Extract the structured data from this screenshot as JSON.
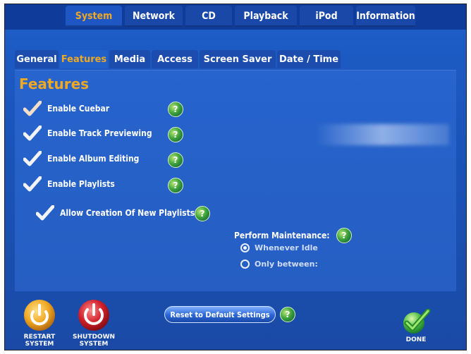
{
  "top_tabs": [
    {
      "label": "System",
      "active": true
    },
    {
      "label": "Network",
      "active": false
    },
    {
      "label": "CD",
      "active": false
    },
    {
      "label": "Playback",
      "active": false
    },
    {
      "label": "iPod",
      "active": false
    },
    {
      "label": "Information",
      "active": false
    }
  ],
  "sub_tabs": [
    {
      "label": "General",
      "active": false
    },
    {
      "label": "Features",
      "active": true
    },
    {
      "label": "Media",
      "active": false
    },
    {
      "label": "Access",
      "active": false
    },
    {
      "label": "Screen Saver",
      "active": false
    },
    {
      "label": "Date / Time",
      "active": false
    }
  ],
  "section_title": "Features",
  "options": [
    {
      "label": "Enable Cuebar",
      "checked": true
    },
    {
      "label": "Enable Track Previewing",
      "checked": true
    },
    {
      "label": "Enable Album Editing",
      "checked": true
    },
    {
      "label": "Enable Playlists",
      "checked": true
    },
    {
      "label": "Allow Creation Of New Playlists",
      "checked": true
    }
  ],
  "maintenance": {
    "label": "Perform Maintenance:",
    "choices": [
      {
        "label": "Whenever Idle",
        "selected": true
      },
      {
        "label": "Only between:",
        "selected": false
      }
    ]
  },
  "help_icon": "?",
  "reset_button": "Reset to Default Settings",
  "restart": {
    "line1": "RESTART",
    "line2": "SYSTEM"
  },
  "shutdown": {
    "line1": "SHUTDOWN",
    "line2": "SYSTEM"
  },
  "done": "DONE",
  "colors": {
    "accent": "#f0a823",
    "background": "#1a56bd",
    "help": "#3fa53a",
    "power": "#d0202a"
  }
}
